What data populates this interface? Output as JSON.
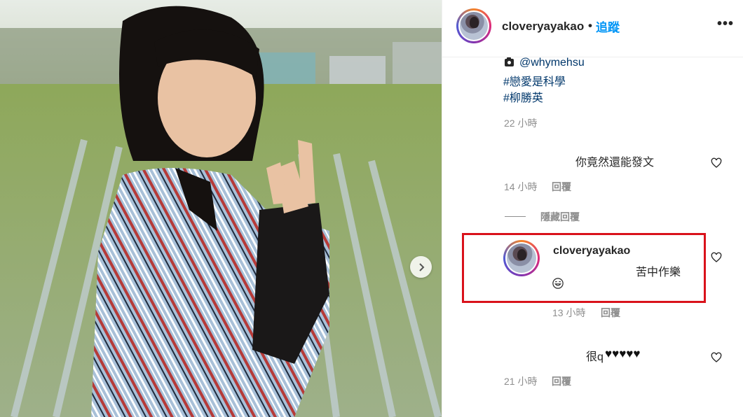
{
  "post": {
    "username": "cloveryayakao",
    "separator": "•",
    "follow_label": "追蹤",
    "more_icon": "more-icon",
    "more_label": "•••"
  },
  "caption": {
    "photo_credit": "@whymehsu",
    "tags": [
      "#戀愛是科學",
      "#柳勝英"
    ],
    "time": "22 小時"
  },
  "comments": [
    {
      "text": "你竟然還能發文",
      "time": "14 小時",
      "reply_label": "回覆"
    },
    {
      "text": "很q",
      "hearts": "♥♥♥♥♥",
      "time": "21 小時",
      "reply_label": "回覆"
    }
  ],
  "replies": {
    "toggle_label": "隱藏回覆",
    "items": [
      {
        "username": "cloveryayakao",
        "text": "苦中作樂",
        "emoji": "smiling-face-icon",
        "time": "13 小時",
        "reply_label": "回覆"
      }
    ]
  },
  "colors": {
    "link": "#0095f6",
    "highlight_box": "#d9121b",
    "meta_text": "#8e8e8e"
  }
}
